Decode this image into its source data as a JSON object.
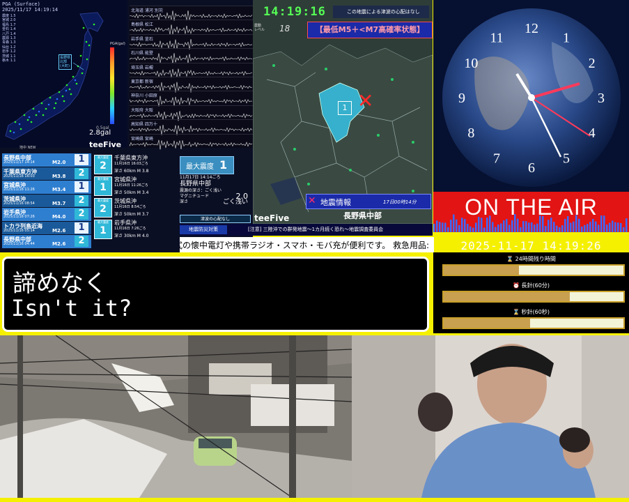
{
  "quake_map": {
    "header": "PGA (Surface)\n2025/11/17 14:19:14",
    "stations": [
      "震度 1.5",
      "宮城 2.0",
      "福島 1.7",
      "釜石 1.4",
      "八戸 1.4",
      "震源 1.3",
      "青森 1.3",
      "仙台 1.2",
      "岩手 1.2",
      "茨城 1.1",
      "栃木 1.1"
    ],
    "scale_label": "PGA(gal)",
    "region_tag": "長野県\n北部\n(大町)",
    "gal_value": "2.8gal",
    "gal_small": "0.5gal"
  },
  "waveforms": [
    "北海道 浦河 別苅",
    "島根県 松江",
    "岩手県 釜石",
    "石川県 能登",
    "埼玉県 岩槻",
    "東京都 新宿",
    "神奈川 小田原",
    "大阪府 大阪",
    "高知県 四万十",
    "宮崎県 宮崎"
  ],
  "brand_pre": "地中 NEW",
  "brand": "teeFive",
  "quake_list": [
    {
      "name": "長野県中部",
      "date": "2025/11/17 14:14",
      "mag": "M2.0",
      "int": "1",
      "color": "#2f8fe0"
    },
    {
      "name": "千葉県東方沖",
      "date": "2025/11/16 16:03",
      "mag": "M3.8",
      "int": "2",
      "color": "#2f8fe0"
    },
    {
      "name": "宮城県沖",
      "date": "2025/11/16 11:26",
      "mag": "M3.4",
      "int": "1",
      "color": "#2f8fe0"
    },
    {
      "name": "茨城県沖",
      "date": "2025/11/16 08:54",
      "mag": "M3.7",
      "int": "2",
      "color": "#2f8fe0"
    },
    {
      "name": "岩手県沖",
      "date": "2025/11/16 07:26",
      "mag": "M4.0",
      "int": "2",
      "color": "#2f8fe0"
    },
    {
      "name": "トカラ列島近海",
      "date": "2025/11/16 05:14",
      "mag": "M2.6",
      "int": "1",
      "color": "#2f8fe0"
    },
    {
      "name": "長野県中部",
      "date": "2025/11/16 04:44",
      "mag": "M2.6",
      "int": "2",
      "color": "#2f8fe0"
    }
  ],
  "detail_list": [
    {
      "badge_label": "最大震度",
      "int": "2",
      "title": "千葉県東方沖",
      "sub": "11月16日 16:03ごろ",
      "mag": "深さ  60km  M 3.8"
    },
    {
      "badge_label": "最大震度",
      "int": "1",
      "title": "宮城県沖",
      "sub": "11月16日 11:26ごろ",
      "mag": "深さ  50km  M 3.4"
    },
    {
      "badge_label": "最大震度",
      "int": "2",
      "title": "茨城県沖",
      "sub": "11月16日 8:54ごろ",
      "mag": "深さ  50km  M 3.7"
    },
    {
      "badge_label": "最大震度",
      "int": "1",
      "title": "岩手県沖",
      "sub": "11月16日 7:26ごろ",
      "mag": "深さ  30km  M 4.0"
    }
  ],
  "max_box": {
    "label": "最大震度",
    "value": "1"
  },
  "right_info": {
    "line1": "11月17日 14:14ごろ",
    "line2": "長野県中部",
    "line3": "震源の深さ：ごく浅い",
    "mag_label": "マグニチュード",
    "mag": "2.0",
    "depth_label": "深さ",
    "depth": "ごく浅い"
  },
  "tsunami": "津波の心配なし",
  "ticker": {
    "tag": "地震防災対策",
    "text": "[注意] 三陸沖での群発地震〜1カ月続く恐れ〜地震調査委員会"
  },
  "marquee": "式の懐中電灯や携帯ラジオ・スマホ・モバ充が便利です。 救急用品:",
  "eew": {
    "time": "14:19:16",
    "msg": "この地震による津波の心配はなし",
    "level_label": "震動\nレベル",
    "level": "18",
    "warn": "【最低M5＋<M7高確率状態】",
    "int_mark": "1",
    "info_label": "地震情報",
    "info_time": "17日00時14分",
    "region": "長野県中部",
    "brand": "teeFive"
  },
  "clock": {
    "numbers": [
      "12",
      "1",
      "2",
      "3",
      "4",
      "5",
      "6",
      "7",
      "8",
      "9",
      "10",
      "11"
    ]
  },
  "on_air": "ON THE AIR",
  "datetime": "2025-11-17 14:19:26",
  "progress": [
    {
      "label": "⌛ 24時間残り時間",
      "value": 0.42
    },
    {
      "label": "⏰ 長針(60分)",
      "value": 0.7
    },
    {
      "label": "⌛ 秒針(60秒)",
      "value": 0.48
    }
  ],
  "subtitle": {
    "jp": "諦めなく",
    "en": "Isn't it?"
  },
  "colors": {
    "accent": "#f5f000",
    "on_air": "#e21414",
    "panel_dark": "#0b0f24",
    "map_bg": "#2e3d38",
    "progress_fill": "#c8a050"
  }
}
